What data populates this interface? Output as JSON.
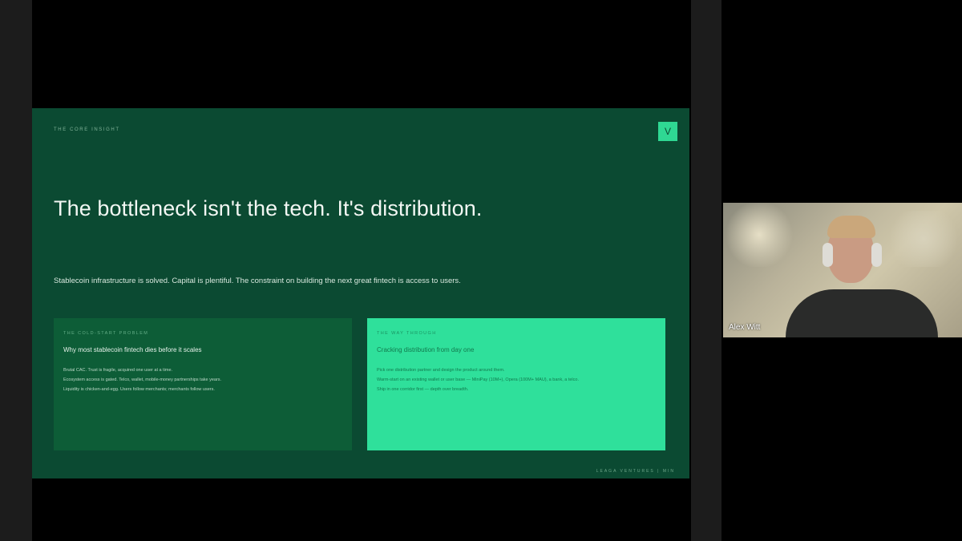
{
  "slide": {
    "eyebrow": "THE CORE INSIGHT",
    "logo_letter": "V",
    "headline": "The bottleneck isn't the tech. It's distribution.",
    "subline": "Stablecoin infrastructure is solved. Capital is plentiful. The constraint on building the next great fintech is access to users.",
    "footer": "LEAGA VENTURES | MIN",
    "cards": [
      {
        "kicker": "THE COLD-START PROBLEM",
        "title": "Why most stablecoin fintech dies before it scales",
        "items": [
          "Brutal CAC. Trust is fragile, acquired one user at a time.",
          "Ecosystem access is gated. Telco, wallet, mobile-money partnerships take years.",
          "Liquidity is chicken-and-egg. Users follow merchants; merchants follow users."
        ]
      },
      {
        "kicker": "THE WAY THROUGH",
        "title": "Cracking distribution from day one",
        "items": [
          "Pick one distribution partner and design the product around them.",
          "Warm-start on an existing wallet or user base — MiniPay (10M+), Opera (100M+ MAU), a bank, a telco.",
          "Ship in one corridor first — depth over breadth."
        ]
      }
    ]
  },
  "participant": {
    "name": "Alex Witt"
  },
  "colors": {
    "slide_bg": "#0b4a32",
    "accent": "#2fe09b"
  }
}
